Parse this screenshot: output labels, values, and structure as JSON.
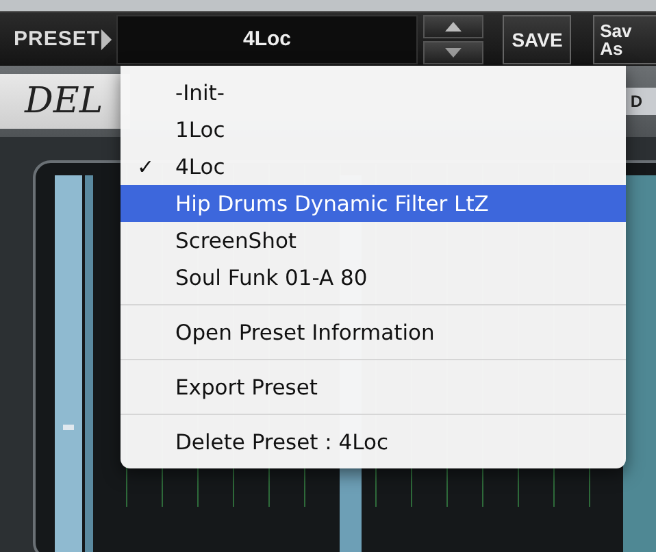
{
  "toolbar": {
    "preset_label": "PRESET",
    "preset_value": "4Loc",
    "save": "SAVE",
    "save_as": [
      "Sav",
      "As"
    ]
  },
  "panel": {
    "title": "DEL",
    "side_label": "D"
  },
  "menu": {
    "presets": [
      {
        "label": "-Init-",
        "checked": false,
        "selected": false
      },
      {
        "label": "1Loc",
        "checked": false,
        "selected": false
      },
      {
        "label": "4Loc",
        "checked": true,
        "selected": false
      },
      {
        "label": "Hip Drums Dynamic Filter LtZ",
        "checked": false,
        "selected": true
      },
      {
        "label": "ScreenShot",
        "checked": false,
        "selected": false
      },
      {
        "label": "Soul Funk 01-A 80",
        "checked": false,
        "selected": false
      }
    ],
    "check_mark": "✓",
    "actions": [
      "Open Preset Information",
      "Export Preset",
      "Delete Preset : 4Loc"
    ]
  }
}
